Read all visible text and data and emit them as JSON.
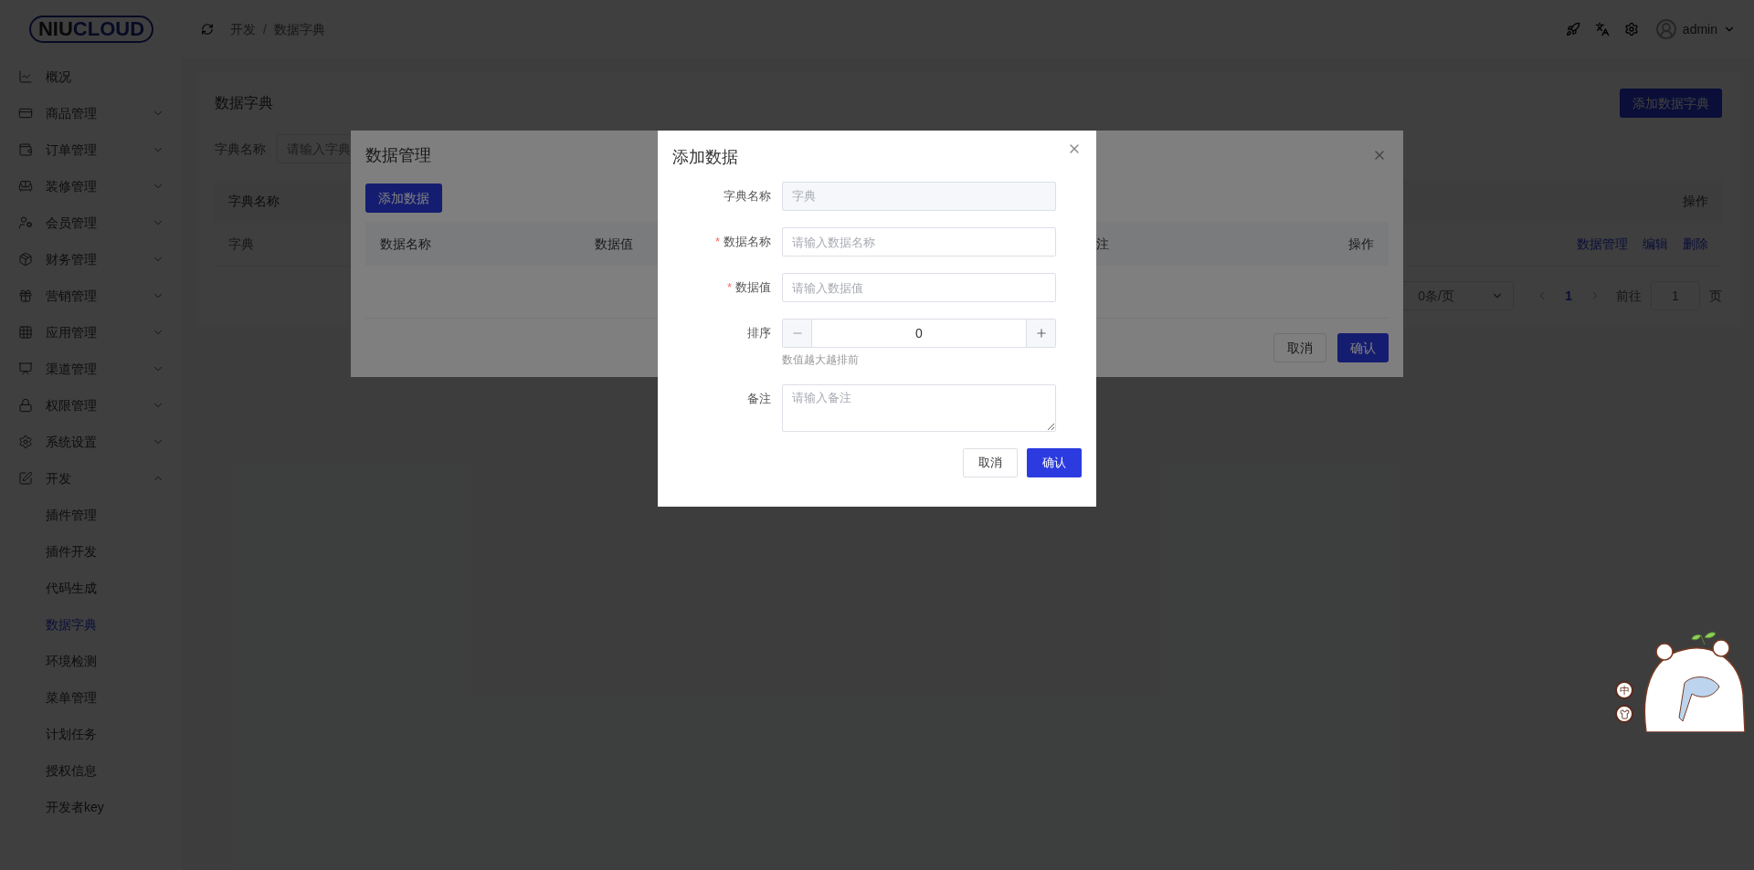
{
  "logo": {
    "dark": "NIU",
    "accent": "CLOUD"
  },
  "sidebar": {
    "items": [
      {
        "kind": "link",
        "label": "概况"
      },
      {
        "kind": "group",
        "label": "商品管理",
        "expanded": false
      },
      {
        "kind": "group",
        "label": "订单管理",
        "expanded": false
      },
      {
        "kind": "group",
        "label": "装修管理",
        "expanded": false
      },
      {
        "kind": "group",
        "label": "会员管理",
        "expanded": false
      },
      {
        "kind": "group",
        "label": "财务管理",
        "expanded": false
      },
      {
        "kind": "group",
        "label": "营销管理",
        "expanded": false
      },
      {
        "kind": "group",
        "label": "应用管理",
        "expanded": false
      },
      {
        "kind": "group",
        "label": "渠道管理",
        "expanded": false
      },
      {
        "kind": "group",
        "label": "权限管理",
        "expanded": false
      },
      {
        "kind": "group",
        "label": "系统设置",
        "expanded": false
      },
      {
        "kind": "group",
        "label": "开发",
        "expanded": true,
        "children": [
          {
            "label": "插件管理",
            "selected": false
          },
          {
            "label": "插件开发",
            "selected": false
          },
          {
            "label": "代码生成",
            "selected": false
          },
          {
            "label": "数据字典",
            "selected": true
          },
          {
            "label": "环境检测",
            "selected": false
          },
          {
            "label": "菜单管理",
            "selected": false
          },
          {
            "label": "计划任务",
            "selected": false
          },
          {
            "label": "授权信息",
            "selected": false
          },
          {
            "label": "开发者key",
            "selected": false
          }
        ]
      }
    ]
  },
  "topbar": {
    "breadcrumb": [
      "开发",
      "数据字典"
    ],
    "separator": "/",
    "user": "admin"
  },
  "page": {
    "title": "数据字典",
    "add_button": "添加数据字典",
    "filter": {
      "label": "字典名称",
      "placeholder": "请输入字典"
    },
    "table": {
      "columns": [
        "字典名称",
        "操作"
      ],
      "rows": [
        {
          "cells": [
            "字典"
          ],
          "actions": [
            "数据管理",
            "编辑",
            "删除"
          ]
        }
      ]
    },
    "pagination": {
      "page_size": "0条/页",
      "pages": [
        {
          "label": "1",
          "selected": true
        }
      ],
      "goto_label": "前往",
      "goto_value": "1",
      "page_suffix": "页"
    }
  },
  "data_modal": {
    "title": "数据管理",
    "add_button": "添加数据",
    "columns": [
      "数据名称",
      "数据值",
      "注",
      "操作"
    ],
    "buttons": {
      "cancel": "取消",
      "confirm": "确认"
    }
  },
  "add_modal": {
    "title": "添加数据",
    "required_mark": "*",
    "fields": [
      {
        "kind": "text",
        "label": "字典名称",
        "required": false,
        "disabled": true,
        "value": "字典"
      },
      {
        "kind": "text",
        "label": "数据名称",
        "required": true,
        "disabled": false,
        "placeholder": "请输入数据名称"
      },
      {
        "kind": "text",
        "label": "数据值",
        "required": true,
        "disabled": false,
        "placeholder": "请输入数据值"
      },
      {
        "kind": "number",
        "label": "排序",
        "value": "0",
        "hint": "数值越大越排前"
      },
      {
        "kind": "textarea",
        "label": "备注",
        "placeholder": "请输入备注"
      }
    ],
    "buttons": {
      "cancel": "取消",
      "confirm": "确认"
    }
  },
  "ime": {
    "mode": "中"
  }
}
